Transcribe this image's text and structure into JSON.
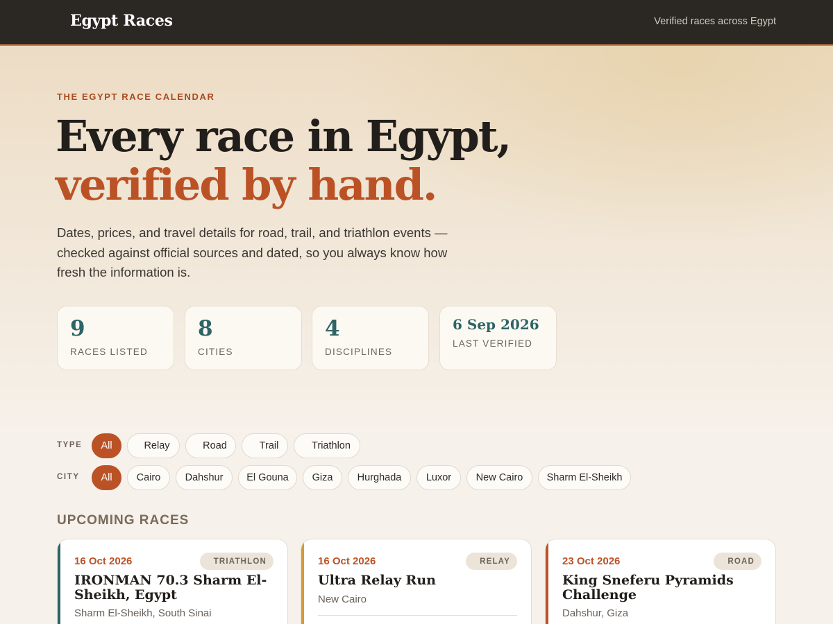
{
  "header": {
    "brand": "Egypt Races",
    "tagline": "Verified races across Egypt"
  },
  "hero": {
    "eyebrow": "THE EGYPT RACE CALENDAR",
    "headline_line1": "Every race in Egypt,",
    "headline_line2": "verified by hand.",
    "lede": "Dates, prices, and travel details for road, trail, and triathlon events — checked against official sources and dated, so you always know how fresh the information is."
  },
  "stats": [
    {
      "value": "9",
      "label": "RACES LISTED"
    },
    {
      "value": "8",
      "label": "CITIES"
    },
    {
      "value": "4",
      "label": "DISCIPLINES"
    },
    {
      "value": "6 Sep 2026",
      "label": "LAST VERIFIED"
    }
  ],
  "filters": {
    "type_label": "TYPE",
    "type_options": [
      "All",
      "Relay",
      "Road",
      "Trail",
      "Triathlon"
    ],
    "type_selected": "All",
    "city_label": "CITY",
    "city_options": [
      "All",
      "Cairo",
      "Dahshur",
      "El Gouna",
      "Giza",
      "Hurghada",
      "Luxor",
      "New Cairo",
      "Sharm El-Sheikh"
    ],
    "city_selected": "All"
  },
  "upcoming": {
    "title": "UPCOMING RACES",
    "races": [
      {
        "date": "16 Oct 2026",
        "type": "TRIATHLON",
        "name": "IRONMAN 70.3 Sharm El-Sheikh, Egypt",
        "location": "Sharm El-Sheikh, South Sinai",
        "stripe": "#2f6466"
      },
      {
        "date": "16 Oct 2026",
        "type": "RELAY",
        "name": "Ultra Relay Run",
        "location": "New Cairo",
        "stripe": "#d49a3a"
      },
      {
        "date": "23 Oct 2026",
        "type": "ROAD",
        "name": "King Sneferu Pyramids Challenge",
        "location": "Dahshur, Giza",
        "stripe": "#bb5226"
      }
    ]
  },
  "colors": {
    "accent": "#bb5226",
    "teal": "#2f6466",
    "topbar": "#2b2824"
  }
}
